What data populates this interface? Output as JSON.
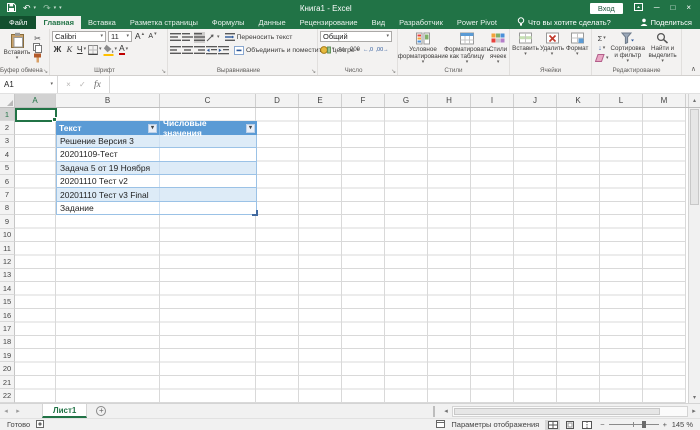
{
  "titlebar": {
    "title": "Книга1 - Excel",
    "signin": "Вход"
  },
  "tabs": [
    "Файл",
    "Главная",
    "Вставка",
    "Разметка страницы",
    "Формулы",
    "Данные",
    "Рецензирование",
    "Вид",
    "Разработчик",
    "Power Pivot"
  ],
  "tellme": "Что вы хотите сделать?",
  "share": "Поделиться",
  "ribbon": {
    "clipboard": {
      "label": "Буфер обмена",
      "paste": "Вставить"
    },
    "font": {
      "label": "Шрифт",
      "name": "Calibri",
      "size": "11"
    },
    "alignment": {
      "label": "Выравнивание",
      "wrap": "Переносить текст",
      "merge": "Объединить и поместить в центре"
    },
    "number": {
      "label": "Число",
      "format": "Общий"
    },
    "styles": {
      "label": "Стили",
      "conditional": "Условное форматирование",
      "as_table": "Форматировать как таблицу",
      "cell_styles": "Стили ячеек"
    },
    "cells": {
      "label": "Ячейки",
      "insert": "Вставить",
      "delete": "Удалить",
      "format": "Формат"
    },
    "editing": {
      "label": "Редактирование",
      "sort": "Сортировка и фильтр",
      "find": "Найти и выделить"
    }
  },
  "formula": {
    "name_box": "A1"
  },
  "grid": {
    "columns": [
      "A",
      "B",
      "C",
      "D",
      "E",
      "F",
      "G",
      "H",
      "I",
      "J",
      "K",
      "L",
      "M"
    ],
    "rows": [
      "1",
      "2",
      "3",
      "4",
      "5",
      "6",
      "7",
      "8",
      "9",
      "10",
      "11",
      "12",
      "13",
      "14",
      "15",
      "16",
      "17",
      "18",
      "19",
      "20",
      "21",
      "22"
    ],
    "selected_cell": "A1"
  },
  "table": {
    "headers": [
      "Текст",
      "Числовые значения"
    ],
    "rows": [
      "Решение Версия 3",
      "20201109-Тест",
      "Задача 5 от 19 Ноября",
      "20201110 Тест v2",
      "20201110 Тест v3 Final",
      "Задание"
    ]
  },
  "sheet": {
    "tab": "Лист1"
  },
  "status": {
    "ready": "Готово",
    "display": "Параметры отображения",
    "zoom": "145 %"
  },
  "icons": {
    "dropdown": "▾",
    "undo": "↶",
    "redo": "↷",
    "scissors": "✂",
    "bold": "Ж",
    "italic": "К",
    "underline": "Ч",
    "letter": "А",
    "sum": "Σ",
    "fill_down": "↓",
    "percent": "%",
    "thousands": "000",
    "increase_decimal": "←,0",
    "decrease_decimal": ",00→",
    "fx": "fx",
    "cancel": "×",
    "enter": "✓",
    "minimize": "─",
    "maximize": "□",
    "close": "×",
    "nav_left": "◂",
    "nav_right": "▸",
    "scroll_up": "▴",
    "scroll_down": "▾",
    "scroll_left": "◂",
    "scroll_right": "▸",
    "add_sheet": "+",
    "launcher": "↘",
    "collapse_ribbon": "∧",
    "zoom_out": "−",
    "zoom_in": "+",
    "filter": "▾"
  },
  "colors": {
    "excel_green": "#217346",
    "table_header_blue": "#5B9BD5",
    "table_band": "#DDEBF7",
    "table_border": "#9BC2E6"
  }
}
